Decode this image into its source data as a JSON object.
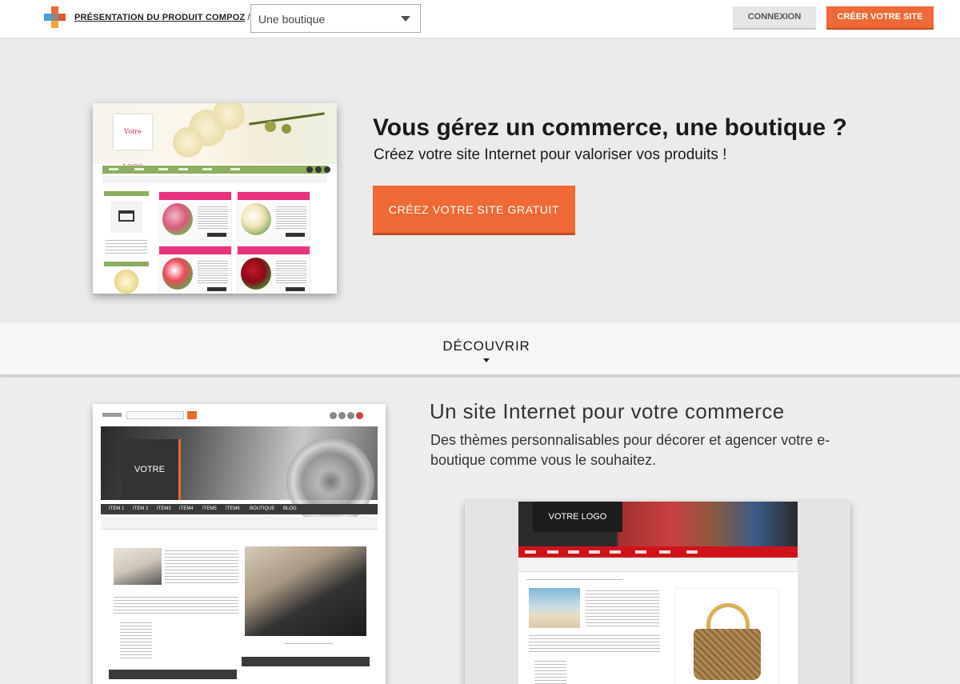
{
  "header": {
    "breadcrumb_link": "PRÉSENTATION DU PRODUIT COMPOZ",
    "breadcrumb_sep": "/",
    "select_value": "Une boutique",
    "login_label": "CONNEXION",
    "create_label": "CRÉER VOTRE SITE"
  },
  "hero": {
    "title": "Vous gérez un commerce, une boutique ?",
    "subtitle": "Créez votre site Internet pour valoriser vos produits !",
    "cta_label": "CRÉEZ VOTRE SITE GRATUIT",
    "mockup_logo": "Votre LOGO"
  },
  "discover": {
    "label": "DÉCOUVRIR"
  },
  "section2": {
    "title": "Un site Internet pour votre commerce",
    "description": "Des thèmes personnalisables pour décorer et agencer votre e-boutique comme vous le souhaitez.",
    "mockup_left_logo": "VOTRE LOGO",
    "mockup_left_nav": [
      "ITEM 1",
      "ITEM 2",
      "ITEM3",
      "ITEM4",
      "ITEM5",
      "ITEM6",
      "BOUTIQUE",
      "BLOG"
    ],
    "mockup_right_logo": "VOTRE LOGO"
  },
  "colors": {
    "accent": "#ef6936",
    "accent_dark": "#c44f1f",
    "hero_bg": "#ebebeb",
    "nav_green": "#8cae5e",
    "flower_pink": "#e8337d",
    "bag_red": "#d0131b"
  }
}
